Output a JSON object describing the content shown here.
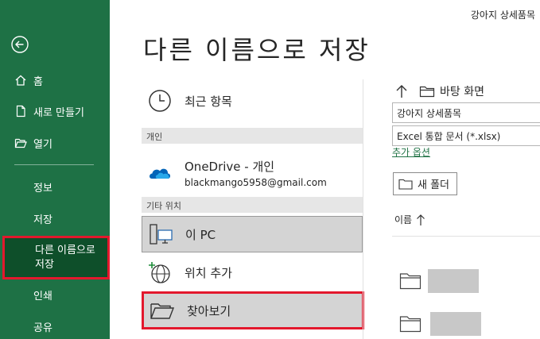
{
  "window": {
    "document_title": "강아지 상세품목"
  },
  "sidebar": {
    "back_icon": "back-arrow-circle-icon",
    "items": [
      {
        "label": "홈",
        "icon": "home-icon"
      },
      {
        "label": "새로 만들기",
        "icon": "new-document-icon"
      },
      {
        "label": "열기",
        "icon": "open-folder-icon"
      },
      {
        "label": "정보"
      },
      {
        "label": "저장"
      },
      {
        "label": "다른 이름으로\n저장",
        "active": true
      },
      {
        "label": "인쇄"
      },
      {
        "label": "공유"
      }
    ],
    "accent_color": "#1e7145"
  },
  "main": {
    "title": "다른 이름으로 저장",
    "recent_label": "최근 항목",
    "section_personal": "개인",
    "onedrive_label": "OneDrive - 개인",
    "onedrive_account": "blackmango5958@gmail.com",
    "section_other": "기타 위치",
    "this_pc_label": "이 PC",
    "add_location_label": "위치 추가",
    "browse_label": "찾아보기"
  },
  "file_pane": {
    "location": "바탕 화면",
    "file_name": "강아지 상세품목",
    "file_type": "Excel 통합 문서 (*.xlsx)",
    "more_options": "추가 옵션",
    "new_folder": "새 폴더",
    "sort_column": "이름"
  },
  "highlight_color": "#e3182d"
}
